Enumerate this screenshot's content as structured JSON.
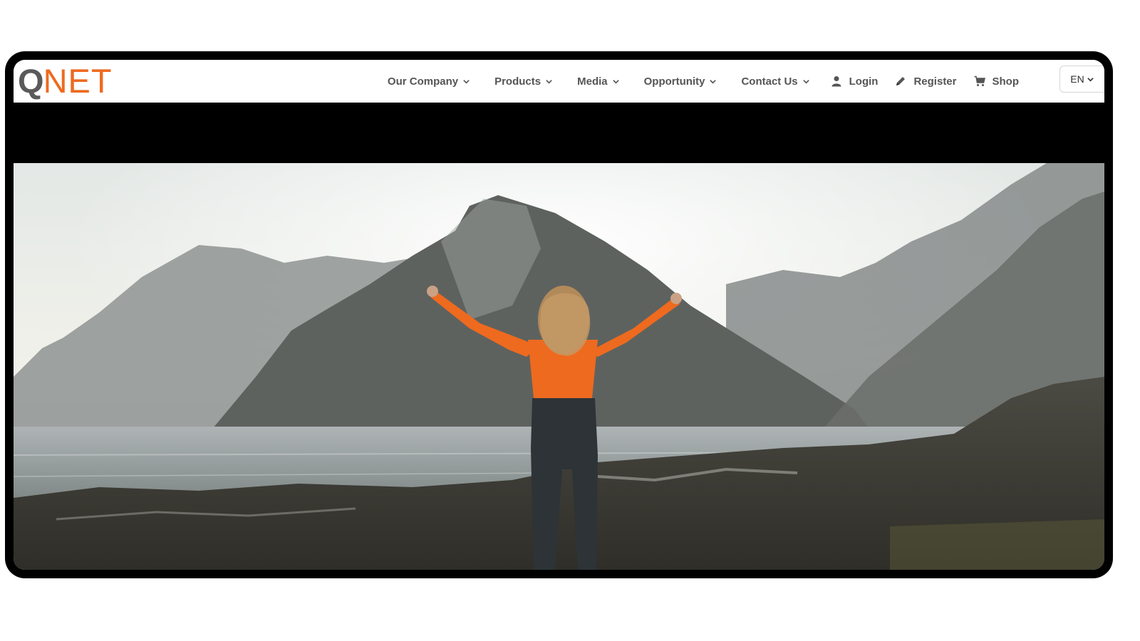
{
  "brand": {
    "logo_q": "Q",
    "logo_rest": "NET",
    "accent_color": "#ee6a1f",
    "logo_gray": "#5a5a5a"
  },
  "nav": {
    "menu": [
      {
        "label": "Our Company",
        "icon": "chevron-down-icon"
      },
      {
        "label": "Products",
        "icon": "chevron-down-icon"
      },
      {
        "label": "Media",
        "icon": "chevron-down-icon"
      },
      {
        "label": "Opportunity",
        "icon": "chevron-down-icon"
      },
      {
        "label": "Contact Us",
        "icon": "chevron-down-icon"
      }
    ],
    "login": {
      "label": "Login",
      "icon": "user-icon"
    },
    "register": {
      "label": "Register",
      "icon": "pencil-icon"
    },
    "shop": {
      "label": "Shop",
      "icon": "cart-icon"
    },
    "language": {
      "label": "EN",
      "icon": "chevron-down-icon"
    }
  },
  "hero": {
    "shirt_color": "#ee6a1f"
  }
}
